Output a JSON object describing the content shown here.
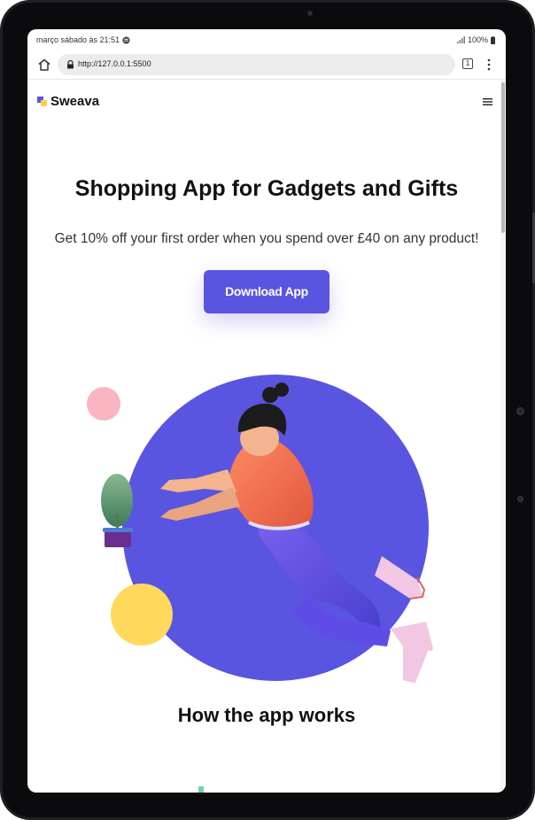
{
  "status": {
    "time_text": "março sábado às 21:51",
    "battery": "100%"
  },
  "browser": {
    "url": "http://127.0.0.1:5500",
    "tab_count": "1"
  },
  "site": {
    "brand": "Sweava",
    "hero": {
      "title": "Shopping App for Gadgets and Gifts",
      "subtitle": "Get 10% off your first order when you spend over £40 on any product!",
      "cta_label": "Download App"
    },
    "section_title": "How the app works"
  },
  "colors": {
    "accent": "#5a55e0",
    "pink": "#f9b5c1",
    "yellow": "#ffd85c",
    "teal": "#6fd3b6"
  },
  "icons": [
    "home-icon",
    "lock-icon",
    "tabs-icon",
    "more-vert-icon",
    "hamburger-menu-icon",
    "signal-icon",
    "battery-icon",
    "notification-icon"
  ]
}
